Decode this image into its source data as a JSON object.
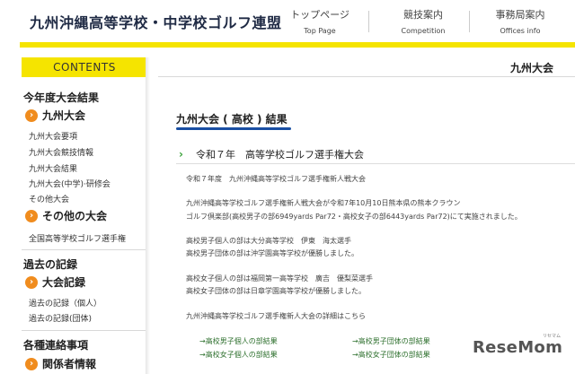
{
  "header": {
    "site_title": "九州沖縄高等学校・中学校ゴルフ連盟",
    "nav": [
      {
        "jp": "トップページ",
        "en": "Top Page"
      },
      {
        "jp": "競技案内",
        "en": "Competition"
      },
      {
        "jp": "事務局案内",
        "en": "Offices info"
      }
    ]
  },
  "sidebar": {
    "contents_label": "CONTENTS",
    "section1": {
      "title": "今年度大会結果",
      "sub1": "九州大会",
      "links1": [
        "九州大会要項",
        "九州大会競技情報",
        "九州大会結果",
        "九州大会(中学)·研修会",
        "その他大会"
      ],
      "sub2": "その他の大会",
      "links2": [
        "全国高等学校ゴルフ選手権"
      ]
    },
    "section2": {
      "title": "過去の記録",
      "sub1": "大会記録",
      "links": [
        "過去の記録（個人）",
        "過去の記録(団体)"
      ]
    },
    "section3": {
      "title": "各種連絡事項",
      "sub1": "関係者情報"
    }
  },
  "main": {
    "header_title": "九州大会",
    "page_title": "九州大会 ( 高校 ) 結果",
    "subheading": "令和７年　高等学校ゴルフ選手権大会",
    "paragraphs": [
      "令和７年度　九州沖縄高等学校ゴルフ選手権新人戦大会",
      "九州沖縄高等学校ゴルフ選手権新人戦大会が令和7年10月10日熊本県の熊本クラウン",
      "ゴルフ倶楽部(高校男子の部6949yards Par72・高校女子の部6443yards Par72)にて実施されました。",
      "高校男子個人の部は大分高等学校　伊東　海太選手",
      "高校男子団体の部は沖学園高等学校が優勝しました。",
      "高校女子個人の部は福岡第一高等学校　廣吉　優梨菜選手",
      "高校女子団体の部は日章学園高等学校が優勝しました。",
      "九州沖縄高等学校ゴルフ選手権新人大会の詳細はこちら"
    ],
    "result_links": [
      "→高校男子個人の部結果",
      "→高校男子団体の部結果",
      "→高校女子個人の部結果",
      "→高校女子団体の部結果"
    ]
  },
  "watermark": {
    "brand": "ReseMom",
    "tagline": "リセマム"
  },
  "colors": {
    "accent_yellow": "#f5e400",
    "icon_orange": "#f08c1e",
    "title_underline": "#1a4fa3",
    "chevron_green": "#3aa23a"
  }
}
